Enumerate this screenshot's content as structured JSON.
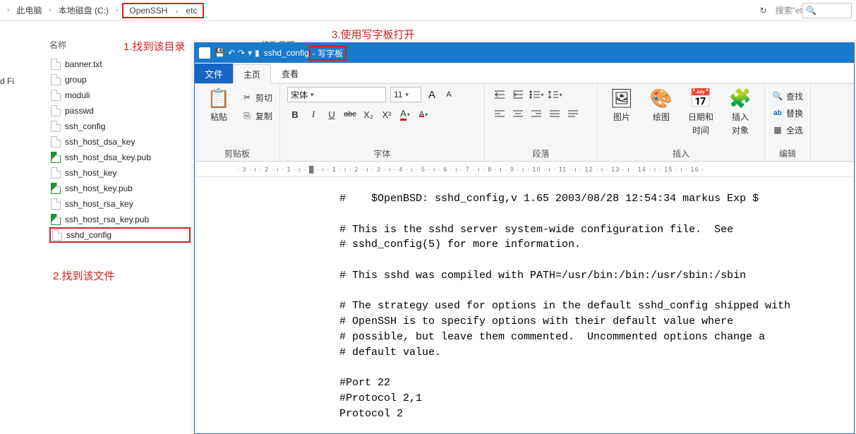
{
  "breadcrumbs": {
    "items": [
      "此电脑",
      "本地磁盘 (C:)",
      "OpenSSH",
      "etc"
    ],
    "boxed_start_index": 2,
    "refresh_glyph": "↻",
    "search_placeholder": "搜索\"et",
    "search_icon": "🔍"
  },
  "explorer": {
    "name_header": "名称",
    "mod_header": "修改日期",
    "left_truncated": "d Fi",
    "files": [
      {
        "name": "banner.txt",
        "type": "txt"
      },
      {
        "name": "group",
        "type": "txt"
      },
      {
        "name": "moduli",
        "type": "txt"
      },
      {
        "name": "passwd",
        "type": "txt"
      },
      {
        "name": "ssh_config",
        "type": "txt"
      },
      {
        "name": "ssh_host_dsa_key",
        "type": "txt"
      },
      {
        "name": "ssh_host_dsa_key.pub",
        "type": "pub"
      },
      {
        "name": "ssh_host_key",
        "type": "txt"
      },
      {
        "name": "ssh_host_key.pub",
        "type": "pub"
      },
      {
        "name": "ssh_host_rsa_key",
        "type": "txt"
      },
      {
        "name": "ssh_host_rsa_key.pub",
        "type": "pub"
      },
      {
        "name": "sshd_config",
        "type": "txt",
        "selected": true
      }
    ]
  },
  "annotations": {
    "a1": "1.找到该目录",
    "a2": "2.找到该文件",
    "a3": "3.使用写字板打开"
  },
  "wordpad": {
    "title_file": "sshd_config",
    "title_app": "写字板",
    "title_sep": " - ",
    "qat": {
      "save": "💾",
      "undo": "↶",
      "redo": "↷",
      "dd": "▾",
      "bar": "▮"
    },
    "tabs": {
      "file": "文件",
      "home": "主页",
      "view": "查看"
    },
    "ribbon": {
      "clipboard": {
        "label": "剪贴板",
        "paste": "粘贴",
        "cut": "剪切",
        "copy": "复制",
        "cut_icon": "✂",
        "copy_icon": "⎘",
        "paste_icon": "📋"
      },
      "font": {
        "label": "字体",
        "name": "宋体",
        "size": "11",
        "grow": "A",
        "shrink": "A",
        "bold": "B",
        "italic": "I",
        "under": "U",
        "strike": "abc",
        "sub": "X₂",
        "sup": "X²",
        "color": "A",
        "hilite": "A",
        "dd": "▾"
      },
      "paragraph": {
        "label": "段落",
        "dd": "▾"
      },
      "insert": {
        "label": "插入",
        "picture": "图片",
        "paint": "绘图",
        "datetime1": "日期和",
        "datetime2": "时间",
        "object1": "插入",
        "object2": "对象",
        "pic_icon": "🖼",
        "paint_icon": "🎨",
        "date_icon": "📅",
        "obj_icon": "🧩"
      },
      "edit": {
        "label": "编辑",
        "find": "查找",
        "replace": "替换",
        "selectall": "全选",
        "find_icon": "🔍",
        "replace_icon": "ab",
        "sel_icon": "▦"
      }
    },
    "ruler_text": "· 3 · ı · 2 · ı · 1 · ı · █ · ı · 1 · ı · 2 · ı · 3 · ı · 4 · ı · 5 · ı · 6 · ı · 7 · ı · 8 · ı · 9 · ı · 10 · ı · 11 · ı · 12 · ı · 13 · ı · 14 · ı · 15 · ı · 16 ·",
    "document": "#    $OpenBSD: sshd_config,v 1.65 2003/08/28 12:54:34 markus Exp $\n\n# This is the sshd server system-wide configuration file.  See\n# sshd_config(5) for more information.\n\n# This sshd was compiled with PATH=/usr/bin:/bin:/usr/sbin:/sbin\n\n# The strategy used for options in the default sshd_config shipped with\n# OpenSSH is to specify options with their default value where\n# possible, but leave them commented.  Uncommented options change a\n# default value.\n\n#Port 22\n#Protocol 2,1\nProtocol 2"
  }
}
